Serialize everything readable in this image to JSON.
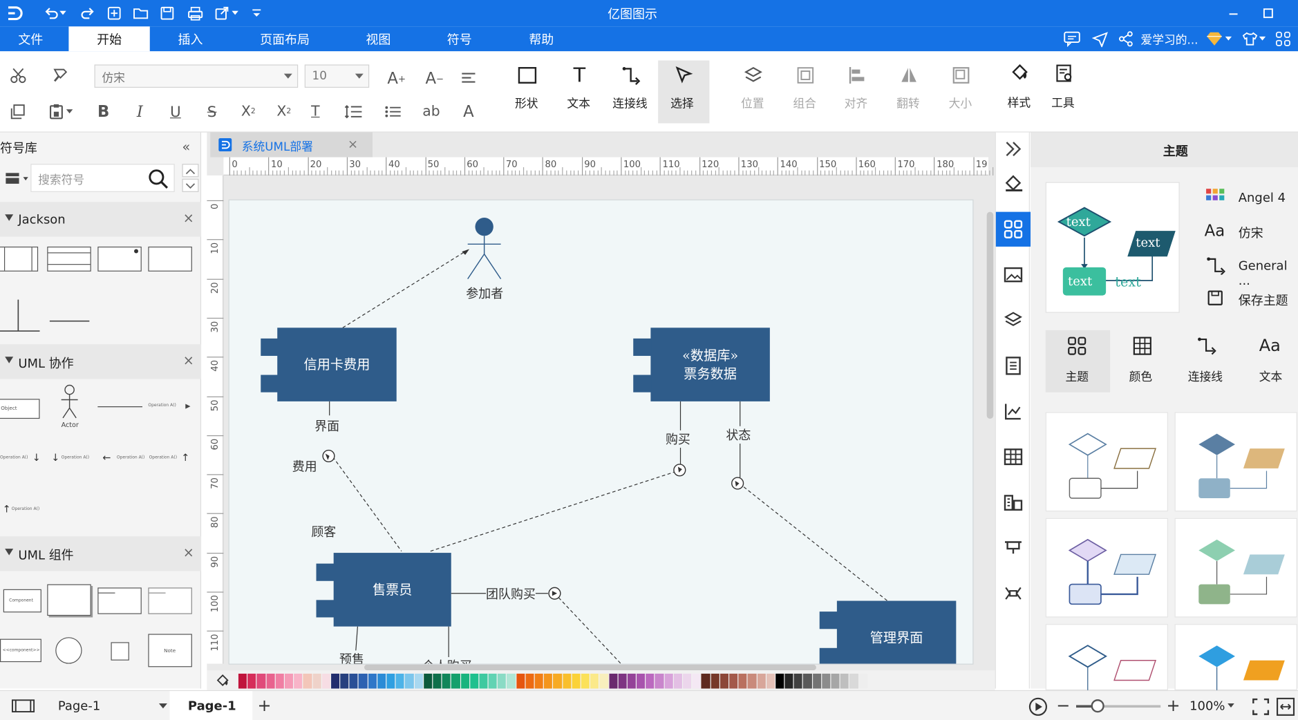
{
  "app": {
    "title": "亿图图示"
  },
  "menu": {
    "items": [
      "文件",
      "开始",
      "插入",
      "页面布局",
      "视图",
      "符号",
      "帮助"
    ],
    "user": "爱学习的..."
  },
  "ribbon": {
    "font_name": "仿宋",
    "font_size": "10",
    "tools": {
      "shape": "形状",
      "text": "文本",
      "connector": "连接线",
      "select": "选择"
    },
    "arrange": {
      "position": "位置",
      "group": "组合",
      "align": "对齐",
      "flip": "翻转",
      "size": "大小"
    },
    "style": "样式",
    "tools_btn": "工具"
  },
  "library": {
    "title": "符号库",
    "search_placeholder": "搜索符号",
    "sections": [
      "Jackson",
      "UML 协作",
      "UML 组件"
    ],
    "collab_actor": "Actor",
    "op_label": "Operation A()",
    "objectname": "Object",
    "component_label": "Component",
    "component2_label": "<<component>>",
    "note_label": "Note"
  },
  "document": {
    "tab_title": "系统UML部署"
  },
  "ruler": {
    "h_ticks": [
      "0",
      "10",
      "20",
      "30",
      "40",
      "50",
      "60",
      "70",
      "80",
      "90",
      "100",
      "110",
      "120",
      "130",
      "140",
      "150",
      "160",
      "170",
      "180",
      "19"
    ],
    "v_ticks": [
      "0",
      "10",
      "20",
      "30",
      "40",
      "50",
      "60",
      "70",
      "80",
      "90",
      "100",
      "110"
    ]
  },
  "diagram": {
    "actor": "参加者",
    "credit": "信用卡费用",
    "db_line1": "«数据库»",
    "db_line2": "票务数据",
    "seller": "售票员",
    "admin": "管理界面",
    "iface": "界面",
    "fee": "费用",
    "buy": "购买",
    "status": "状态",
    "customer": "顾客",
    "group_buy": "团队购买",
    "presale": "预售",
    "individual_buy": "个人购买"
  },
  "right_panel": {
    "title": "主题",
    "theme_name": "Angel 4",
    "font": "仿宋",
    "connector": "General ...",
    "save": "保存主题",
    "preview_text": "text",
    "tabs": [
      "主题",
      "颜色",
      "连接线",
      "文本"
    ]
  },
  "status": {
    "page_select": "Page-1",
    "page_tab": "Page-1",
    "zoom": "100%"
  },
  "palette_colors": [
    "#c0143c",
    "#d62d5a",
    "#e04a7a",
    "#e8638e",
    "#f07ea3",
    "#f59bb7",
    "#f8b4c8",
    "#f3c6b9",
    "#efd2c9",
    "#f7dde4",
    "#222e6e",
    "#27407e",
    "#2a4f96",
    "#2d61b1",
    "#2f77c8",
    "#2b8bd6",
    "#2f9fe1",
    "#4db3e8",
    "#7cc6ec",
    "#a8d8f0",
    "#0b5a3c",
    "#0e6f4a",
    "#11865a",
    "#15a06c",
    "#19b47e",
    "#1fc08e",
    "#3ec9a0",
    "#61d3b3",
    "#8adbc5",
    "#b0e6d6",
    "#e6560f",
    "#ed6b13",
    "#f17f17",
    "#f4951c",
    "#f7aa23",
    "#f9bf2c",
    "#fbd238",
    "#fbe15a",
    "#fbe98a",
    "#f8efbd",
    "#6a2a6e",
    "#7e3482",
    "#944298",
    "#a853ad",
    "#bb69bf",
    "#c985cc",
    "#d8a2da",
    "#e3bfe4",
    "#ecd6ec",
    "#f4e8f4",
    "#5e2a1e",
    "#763829",
    "#8c4738",
    "#a3594a",
    "#b9705f",
    "#c98a7b",
    "#d8a69a",
    "#e4c1b8",
    "#000000",
    "#262626",
    "#404040",
    "#595959",
    "#737373",
    "#8c8c8c",
    "#a6a6a6",
    "#bfbfbf",
    "#d9d9d9",
    "#eeeeee"
  ]
}
